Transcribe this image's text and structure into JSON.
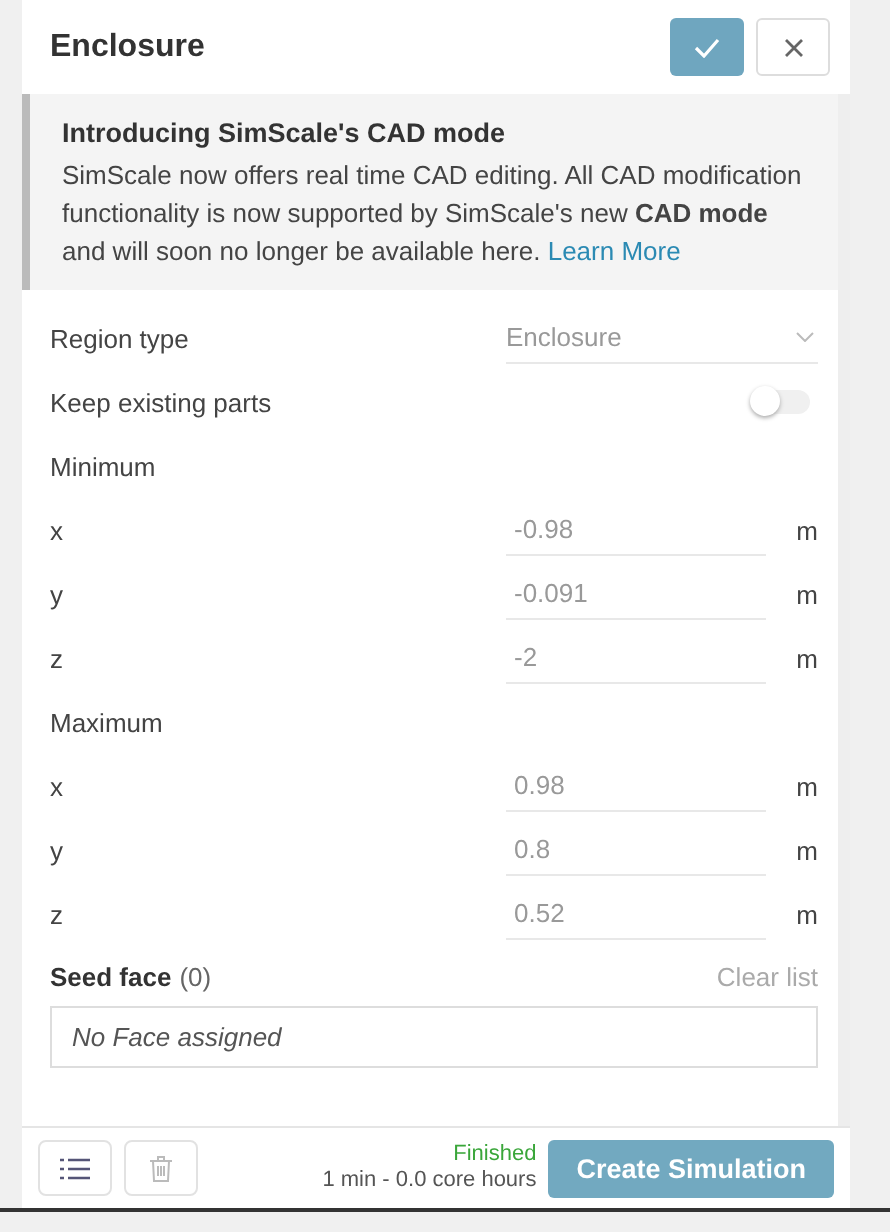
{
  "panel": {
    "title": "Enclosure"
  },
  "notice": {
    "title": "Introducing SimScale's CAD mode",
    "text": "SimScale now offers real time CAD editing. All CAD modification functionality is now supported by SimScale's new **CAD mode** and will soon no longer be available here.",
    "link": "Learn More"
  },
  "region_type": {
    "label": "Region type",
    "value": "Enclosure"
  },
  "keep_existing_parts": {
    "label": "Keep existing parts",
    "on": false
  },
  "groups": [
    {
      "title": "Minimum",
      "rows": [
        {
          "axis": "x",
          "value": "-0.98",
          "unit": "m"
        },
        {
          "axis": "y",
          "value": "-0.091",
          "unit": "m"
        },
        {
          "axis": "z",
          "value": "-2",
          "unit": "m"
        }
      ]
    },
    {
      "title": "Maximum",
      "rows": [
        {
          "axis": "x",
          "value": "0.98",
          "unit": "m"
        },
        {
          "axis": "y",
          "value": "0.8",
          "unit": "m"
        },
        {
          "axis": "z",
          "value": "0.52",
          "unit": "m"
        }
      ]
    }
  ],
  "seed_face": {
    "label": "Seed face",
    "count": "(0)",
    "clear": "Clear list",
    "empty": "No Face assigned"
  },
  "footer": {
    "status": "Finished",
    "detail": "1 min - 0.0 core hours",
    "button": "Create Simulation"
  }
}
